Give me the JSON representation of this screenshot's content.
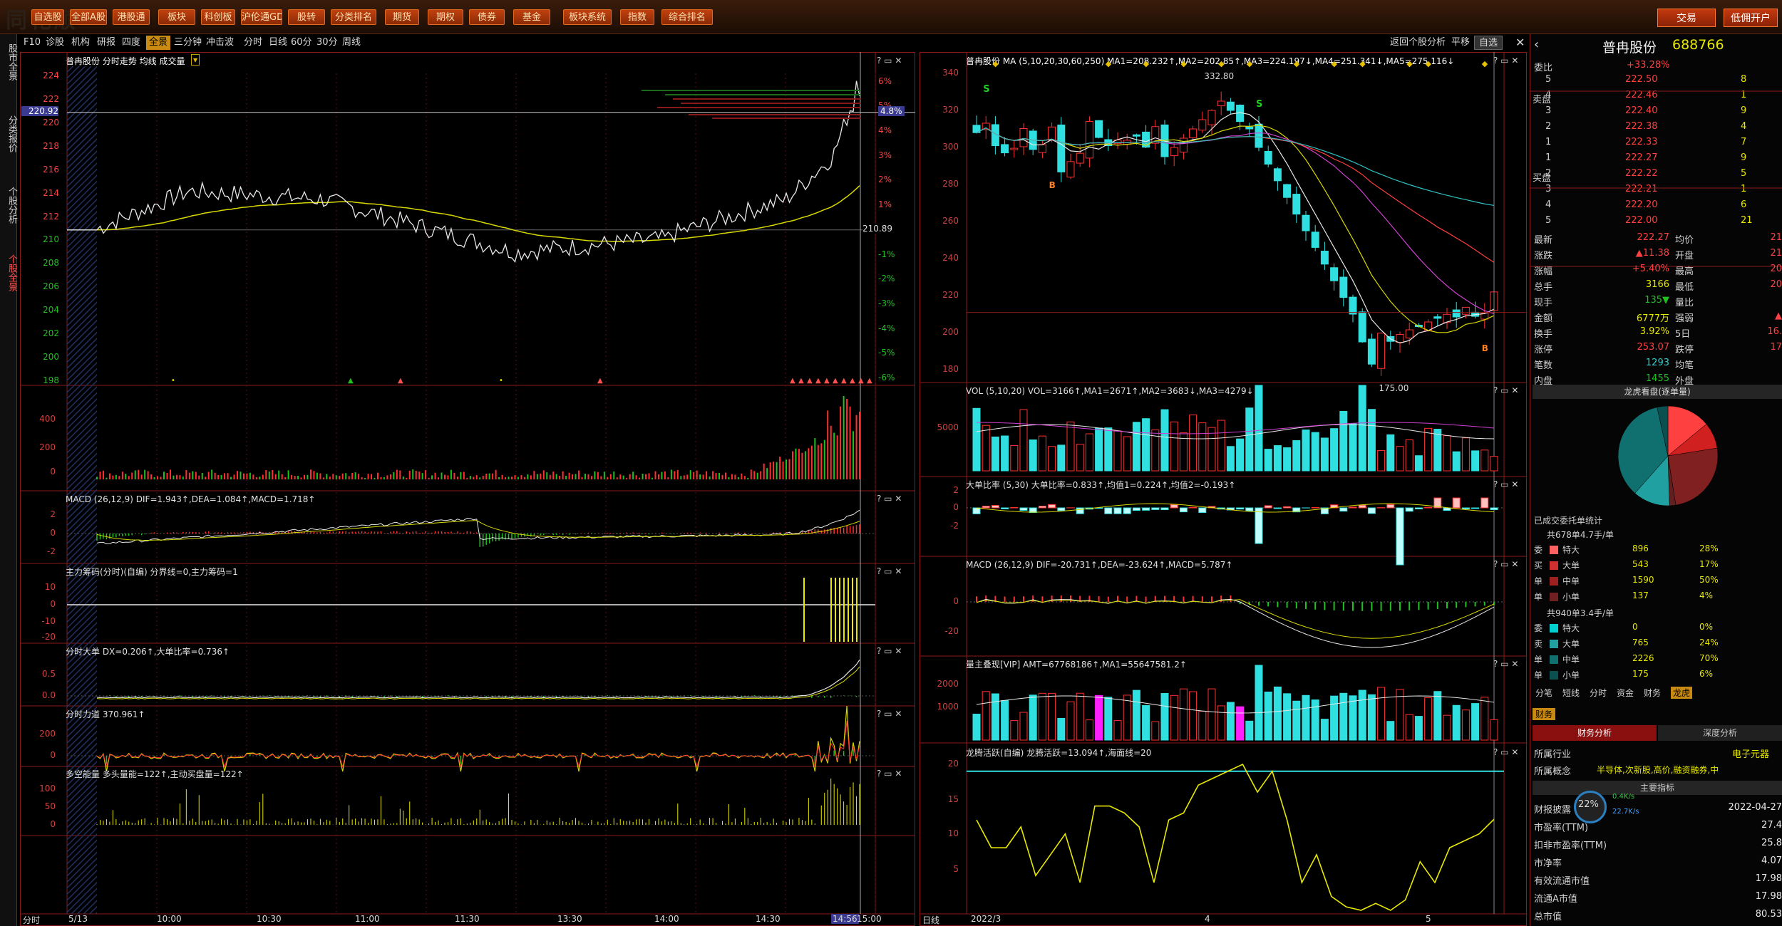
{
  "menubar": {
    "items": [
      "自选股",
      "全部A股",
      "港股通",
      "板块",
      "科创板",
      "沪伦通GDR",
      "股转",
      "分类排名",
      "期货",
      "期权",
      "债券",
      "基金",
      "板块系统",
      "指数",
      "综合排名"
    ],
    "trade_btn": "交易",
    "open_btn": "低佣开户"
  },
  "sidenav": {
    "items": [
      "股市全景",
      "分类报价",
      "个股分析",
      "个股全景"
    ]
  },
  "toolbar_left": {
    "items": [
      "F10",
      "诊股",
      "机构",
      "研报",
      "四度",
      "全景",
      "三分钟",
      "冲击波",
      "分时",
      "日线",
      "60分",
      "30分",
      "周线"
    ]
  },
  "toolbar_right": {
    "back": "返回个股分析",
    "flat": "平移",
    "select": "自选"
  },
  "left_chart": {
    "title": "普冉股份 分时走势 均线 成交量",
    "price_left": [
      "224",
      "222",
      "220",
      "218",
      "216",
      "214",
      "212",
      "210",
      "208",
      "206",
      "204",
      "202",
      "200",
      "198"
    ],
    "price_right_pct": [
      "6%",
      "5%",
      "4%",
      "3%",
      "2%",
      "1%",
      "0%",
      "-1%",
      "-2%",
      "-3%",
      "-4%",
      "-5%",
      "-6%"
    ],
    "cursor_price": "220.92",
    "cursor_pct": "4.8%",
    "mid_price": "210.89",
    "vol_labels": [
      "400",
      "200",
      "0"
    ],
    "macd_title": "MACD (26,12,9) DIF=1.943↑,DEA=1.084↑,MACD=1.718↑",
    "macd_labels": [
      "2",
      "0",
      "-2"
    ],
    "zhuli_title": "主力筹码(分时)(自编) 分界线=0,主力筹码=1",
    "zhuli_labels": [
      "10",
      "0",
      "-10",
      "-20"
    ],
    "dadan_title": "分时大单 DX=0.206↑,大单比率=0.736↑",
    "dadan_labels": [
      "0.5",
      "0.0"
    ],
    "lidao_title": "分时力道 370.961↑",
    "lidao_labels": [
      "200",
      "0"
    ],
    "duokong_title": "多空能量 多头量能=122↑,主动买盘量=122↑",
    "duokong_labels": [
      "100",
      "50",
      "0"
    ],
    "x_labels": [
      "5/13",
      "10:00",
      "10:30",
      "11:00",
      "11:30",
      "13:30",
      "14:00",
      "14:30",
      "14:56",
      "15:00"
    ],
    "x_footer": "分时"
  },
  "right_chart": {
    "title": "普冉股份 MA (5,10,20,30,60,250) MA1=208.232↑,MA2=202.85↑,MA3=224.197↓,MA4=251.341↓,MA5=275.116↓",
    "price_labels": [
      "340",
      "320",
      "300",
      "280",
      "260",
      "240",
      "220",
      "200",
      "180"
    ],
    "high_label": "332.80",
    "low_label": "175.00",
    "vol_title": "VOL (5,10,20) VOL=3166↑,MA1=2671↑,MA2=3683↓,MA3=4279↓",
    "vol_labels": [
      "5000"
    ],
    "ddb_title": "大单比率 (5,30) 大单比率=0.833↑,均值1=0.224↑,均值2=-0.193↑",
    "ddb_labels": [
      "2",
      "0",
      "-2"
    ],
    "macd_title": "MACD (26,12,9) DIF=-20.731↑,DEA=-23.624↑,MACD=5.787↑",
    "macd_labels": [
      "0",
      "-20"
    ],
    "lz_title": "量主叠现[VIP] AMT=67768186↑,MA1=55647581.2↑",
    "lz_labels": [
      "2000",
      "1000"
    ],
    "lt_title": "龙腾活跃(自编) 龙腾活跃=13.094↑,海面线=20",
    "lt_labels": [
      "20",
      "15",
      "10",
      "5"
    ],
    "x_labels": [
      "2022/3",
      "4",
      "5"
    ],
    "x_footer": "日线"
  },
  "quote": {
    "name": "普冉股份",
    "code": "688766",
    "weibi_label": "委比",
    "weibi": "+33.28%",
    "sell": [
      [
        "5",
        "222.50",
        "8"
      ],
      [
        "4",
        "222.46",
        "1"
      ],
      [
        "3",
        "222.40",
        "9"
      ],
      [
        "2",
        "222.38",
        "4"
      ],
      [
        "1",
        "222.33",
        "7"
      ]
    ],
    "buy": [
      [
        "1",
        "222.27",
        "9"
      ],
      [
        "2",
        "222.22",
        "5"
      ],
      [
        "3",
        "222.21",
        "1"
      ],
      [
        "4",
        "222.20",
        "6"
      ],
      [
        "5",
        "222.00",
        "21"
      ]
    ],
    "sell_side": "卖盘",
    "buy_side": "买盘",
    "stats_left": [
      [
        "最新",
        "222.27"
      ],
      [
        "涨跌",
        "▲11.38"
      ],
      [
        "涨幅",
        "+5.40%"
      ],
      [
        "总手",
        "3166"
      ],
      [
        "现手",
        "135▼"
      ],
      [
        "金额",
        "6777万"
      ],
      [
        "换手",
        "3.92%"
      ],
      [
        "涨停",
        "253.07"
      ],
      [
        "笔数",
        "1293"
      ],
      [
        "内盘",
        "1455"
      ]
    ],
    "stats_right": [
      [
        "均价",
        "21"
      ],
      [
        "开盘",
        "21"
      ],
      [
        "最高",
        "20"
      ],
      [
        "最低",
        "20"
      ],
      [
        "量比",
        ""
      ],
      [
        "强弱",
        "▲"
      ],
      [
        "5日",
        "16."
      ],
      [
        "跌停",
        "17"
      ],
      [
        "均笔",
        ""
      ],
      [
        "外盘",
        ""
      ]
    ],
    "pie_title": "龙虎看盘(逐单量)",
    "order_title": "已成交委托单统计",
    "sell_stat_title": "共678单4.7手/单",
    "sell_rows": [
      [
        "特大",
        "896",
        "28%"
      ],
      [
        "大单",
        "543",
        "17%"
      ],
      [
        "中单",
        "1590",
        "50%"
      ],
      [
        "小单",
        "137",
        "4%"
      ]
    ],
    "buy_stat_title": "共940单3.4手/单",
    "buy_rows": [
      [
        "特大",
        "0",
        "0%"
      ],
      [
        "大单",
        "765",
        "24%"
      ],
      [
        "中单",
        "2226",
        "70%"
      ],
      [
        "小单",
        "175",
        "6%"
      ]
    ],
    "side_labels": [
      "委",
      "买",
      "单",
      "委",
      "卖",
      "单"
    ],
    "bottom_tabs": [
      "分笔",
      "短线",
      "分时",
      "资金",
      "财务",
      "龙虎"
    ],
    "fin_tab": "财务",
    "fin_tabs": [
      "财务分析",
      "深度分析"
    ],
    "industry_label": "所属行业",
    "industry": "电子元器",
    "concept_label": "所属概念",
    "concept": "半导体,次新股,高价,融资融券,中",
    "main_index": "主要指标",
    "net_pct": "22%",
    "net_up": "0.4K/s",
    "net_down": "22.7K/s",
    "fin_rows": [
      [
        "财报披露",
        "2022-04-27"
      ],
      [
        "市盈率(TTM)",
        "27.4"
      ],
      [
        "扣非市盈率(TTM)",
        "25.8"
      ],
      [
        "市净率",
        "4.07"
      ],
      [
        "有效流通市值",
        "17.98"
      ],
      [
        "流通A市值",
        "17.98"
      ],
      [
        "总市值",
        "80.53"
      ]
    ]
  }
}
